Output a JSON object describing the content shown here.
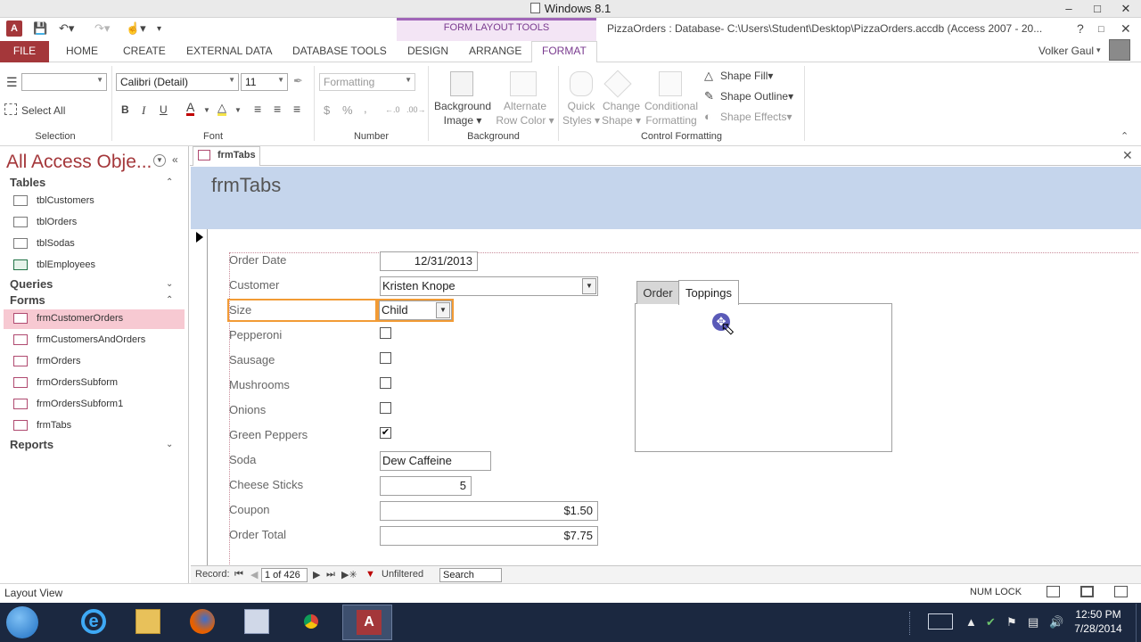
{
  "window": {
    "title": "Windows 8.1"
  },
  "title_bar": {
    "context_group": "FORM LAYOUT TOOLS",
    "document_title": "PizzaOrders : Database- C:\\Users\\Student\\Desktop\\PizzaOrders.accdb (Access 2007 - 20...",
    "user_name": "Volker Gaul",
    "help": "?"
  },
  "ribbon_tabs": [
    "FILE",
    "HOME",
    "CREATE",
    "EXTERNAL DATA",
    "DATABASE TOOLS",
    "DESIGN",
    "ARRANGE",
    "FORMAT"
  ],
  "ribbon": {
    "selection": {
      "label": "Selection",
      "select_all": "Select All"
    },
    "font": {
      "label": "Font",
      "font_name": "Calibri (Detail)",
      "font_size": "11",
      "bold": "B",
      "italic": "I",
      "underline": "U",
      "font_color_glyph": "A"
    },
    "number": {
      "label": "Number",
      "format": "Formatting",
      "currency": "$",
      "percent": "%",
      "comma": ",",
      "inc_decimals": "←.0",
      "dec_decimals": ".00→"
    },
    "background": {
      "label": "Background",
      "background_image": "Background Image",
      "alternate_row_color": "Alternate Row Color"
    },
    "control_formatting": {
      "label": "Control Formatting",
      "quick_styles": "Quick Styles",
      "change_shape": "Change Shape",
      "conditional_formatting": "Conditional Formatting",
      "shape_fill": "Shape Fill",
      "shape_outline": "Shape Outline",
      "shape_effects": "Shape Effects"
    }
  },
  "nav_pane": {
    "title": "All Access Obje...",
    "groups": [
      {
        "name": "Tables",
        "items": [
          "tblCustomers",
          "tblOrders",
          "tblSodas",
          "tblEmployees"
        ]
      },
      {
        "name": "Queries",
        "items": []
      },
      {
        "name": "Forms",
        "items": [
          "frmCustomerOrders",
          "frmCustomersAndOrders",
          "frmOrders",
          "frmOrdersSubform",
          "frmOrdersSubform1",
          "frmTabs"
        ]
      },
      {
        "name": "Reports",
        "items": []
      }
    ],
    "selected_item": "frmCustomerOrders"
  },
  "document": {
    "tab_label": "frmTabs",
    "form_title": "frmTabs",
    "fields": {
      "order_date": {
        "label": "Order Date",
        "value": "12/31/2013"
      },
      "customer": {
        "label": "Customer",
        "value": "Kristen Knope"
      },
      "size": {
        "label": "Size",
        "value": "Child"
      },
      "pepperoni": {
        "label": "Pepperoni",
        "checked": false
      },
      "sausage": {
        "label": "Sausage",
        "checked": false
      },
      "mushrooms": {
        "label": "Mushrooms",
        "checked": false
      },
      "onions": {
        "label": "Onions",
        "checked": false
      },
      "green_peppers": {
        "label": "Green Peppers",
        "checked": true
      },
      "soda": {
        "label": "Soda",
        "value": "Dew Caffeine"
      },
      "cheese_sticks": {
        "label": "Cheese Sticks",
        "value": "5"
      },
      "coupon": {
        "label": "Coupon",
        "value": "$1.50"
      },
      "order_total": {
        "label": "Order Total",
        "value": "$7.75"
      }
    },
    "tab_control": {
      "tabs": [
        "Order",
        "Toppings"
      ],
      "active_tab": "Toppings"
    }
  },
  "record_nav": {
    "label": "Record:",
    "position": "1 of 426",
    "filter": "Unfiltered",
    "search": "Search"
  },
  "status_bar": {
    "mode": "Layout View",
    "num_lock": "NUM LOCK"
  },
  "taskbar": {
    "time": "12:50 PM",
    "date": "7/28/2014",
    "apps": [
      "internet-explorer",
      "file-explorer",
      "firefox",
      "app-4",
      "chrome",
      "access"
    ]
  },
  "colors": {
    "access_red": "#a4373a",
    "context_purple": "#a066b8",
    "form_header_blue": "#c5d5ec",
    "selection_orange": "#f29b35",
    "nav_selected_pink": "#f7c9d2"
  }
}
